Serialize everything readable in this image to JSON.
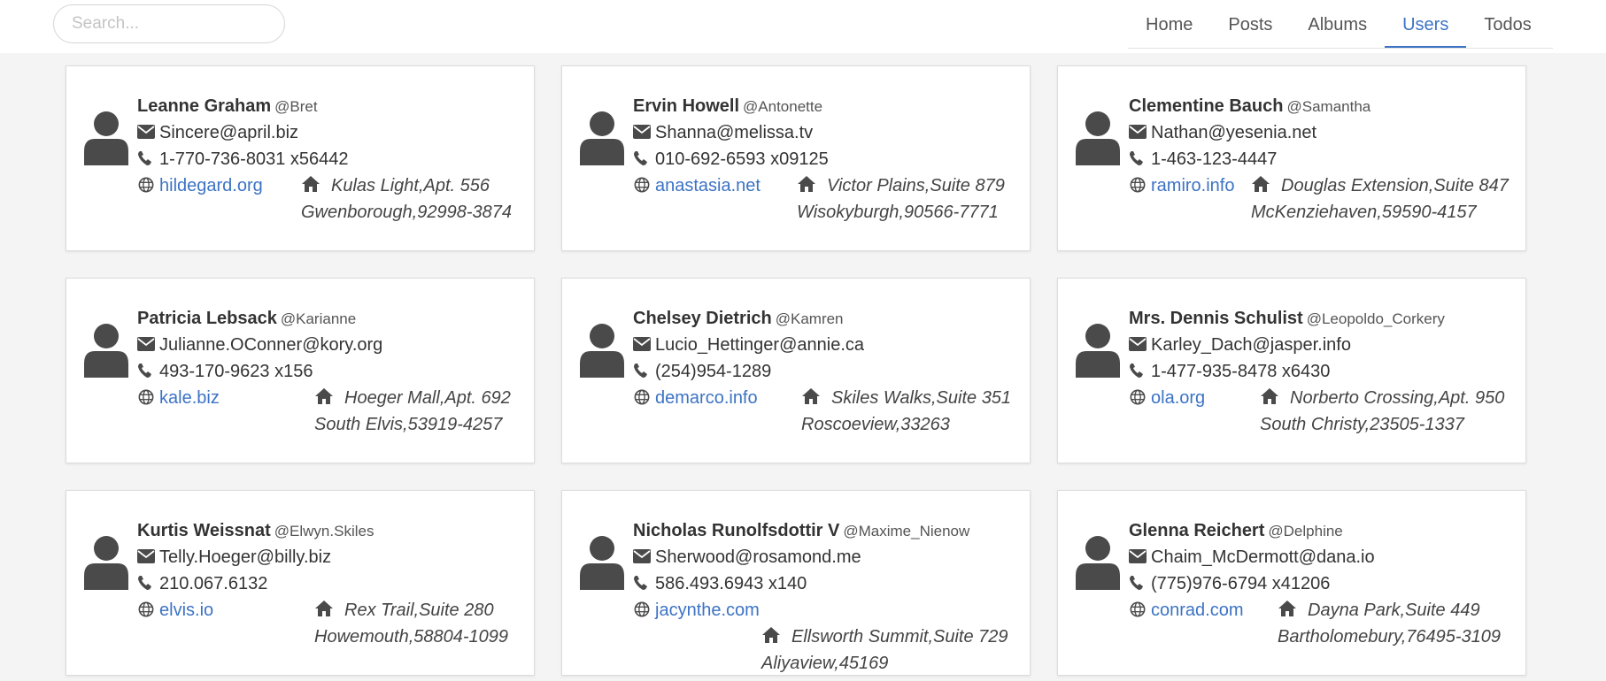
{
  "search": {
    "placeholder": "Search..."
  },
  "nav": [
    {
      "label": "Home",
      "active": false
    },
    {
      "label": "Posts",
      "active": false
    },
    {
      "label": "Albums",
      "active": false
    },
    {
      "label": "Users",
      "active": true
    },
    {
      "label": "Todos",
      "active": false
    }
  ],
  "colors": {
    "accent": "#3c73c4",
    "icon": "#4a4a4a",
    "background": "#f4f4f4"
  },
  "icons": {
    "avatar": "user-icon",
    "email": "envelope-icon",
    "phone": "phone-icon",
    "website": "globe-icon",
    "address": "home-icon"
  },
  "users": [
    {
      "name": "Leanne Graham",
      "username": "@Bret",
      "email": "Sincere@april.biz",
      "phone": "1-770-736-8031 x56442",
      "website": "hildegard.org",
      "street": "Kulas Light,Apt. 556",
      "city": "Gwenborough,92998-3874"
    },
    {
      "name": "Ervin Howell",
      "username": "@Antonette",
      "email": "Shanna@melissa.tv",
      "phone": "010-692-6593 x09125",
      "website": "anastasia.net",
      "street": "Victor Plains,Suite 879",
      "city": "Wisokyburgh,90566-7771"
    },
    {
      "name": "Clementine Bauch",
      "username": "@Samantha",
      "email": "Nathan@yesenia.net",
      "phone": "1-463-123-4447",
      "website": "ramiro.info",
      "street": "Douglas Extension,Suite 847",
      "city": "McKenziehaven,59590-4157"
    },
    {
      "name": "Patricia Lebsack",
      "username": "@Karianne",
      "email": "Julianne.OConner@kory.org",
      "phone": "493-170-9623 x156",
      "website": "kale.biz",
      "street": "Hoeger Mall,Apt. 692",
      "city": "South Elvis,53919-4257"
    },
    {
      "name": "Chelsey Dietrich",
      "username": "@Kamren",
      "email": "Lucio_Hettinger@annie.ca",
      "phone": "(254)954-1289",
      "website": "demarco.info",
      "street": "Skiles Walks,Suite 351",
      "city": "Roscoeview,33263"
    },
    {
      "name": "Mrs. Dennis Schulist",
      "username": "@Leopoldo_Corkery",
      "email": "Karley_Dach@jasper.info",
      "phone": "1-477-935-8478 x6430",
      "website": "ola.org",
      "street": "Norberto Crossing,Apt. 950",
      "city": "South Christy,23505-1337"
    },
    {
      "name": "Kurtis Weissnat",
      "username": "@Elwyn.Skiles",
      "email": "Telly.Hoeger@billy.biz",
      "phone": "210.067.6132",
      "website": "elvis.io",
      "street": "Rex Trail,Suite 280",
      "city": "Howemouth,58804-1099"
    },
    {
      "name": "Nicholas Runolfsdottir V",
      "username": "@Maxime_Nienow",
      "email": "Sherwood@rosamond.me",
      "phone": "586.493.6943 x140",
      "website": "jacynthe.com",
      "street": "Ellsworth Summit,Suite 729",
      "city": "Aliyaview,45169"
    },
    {
      "name": "Glenna Reichert",
      "username": "@Delphine",
      "email": "Chaim_McDermott@dana.io",
      "phone": "(775)976-6794 x41206",
      "website": "conrad.com",
      "street": "Dayna Park,Suite 449",
      "city": "Bartholomebury,76495-3109"
    }
  ]
}
